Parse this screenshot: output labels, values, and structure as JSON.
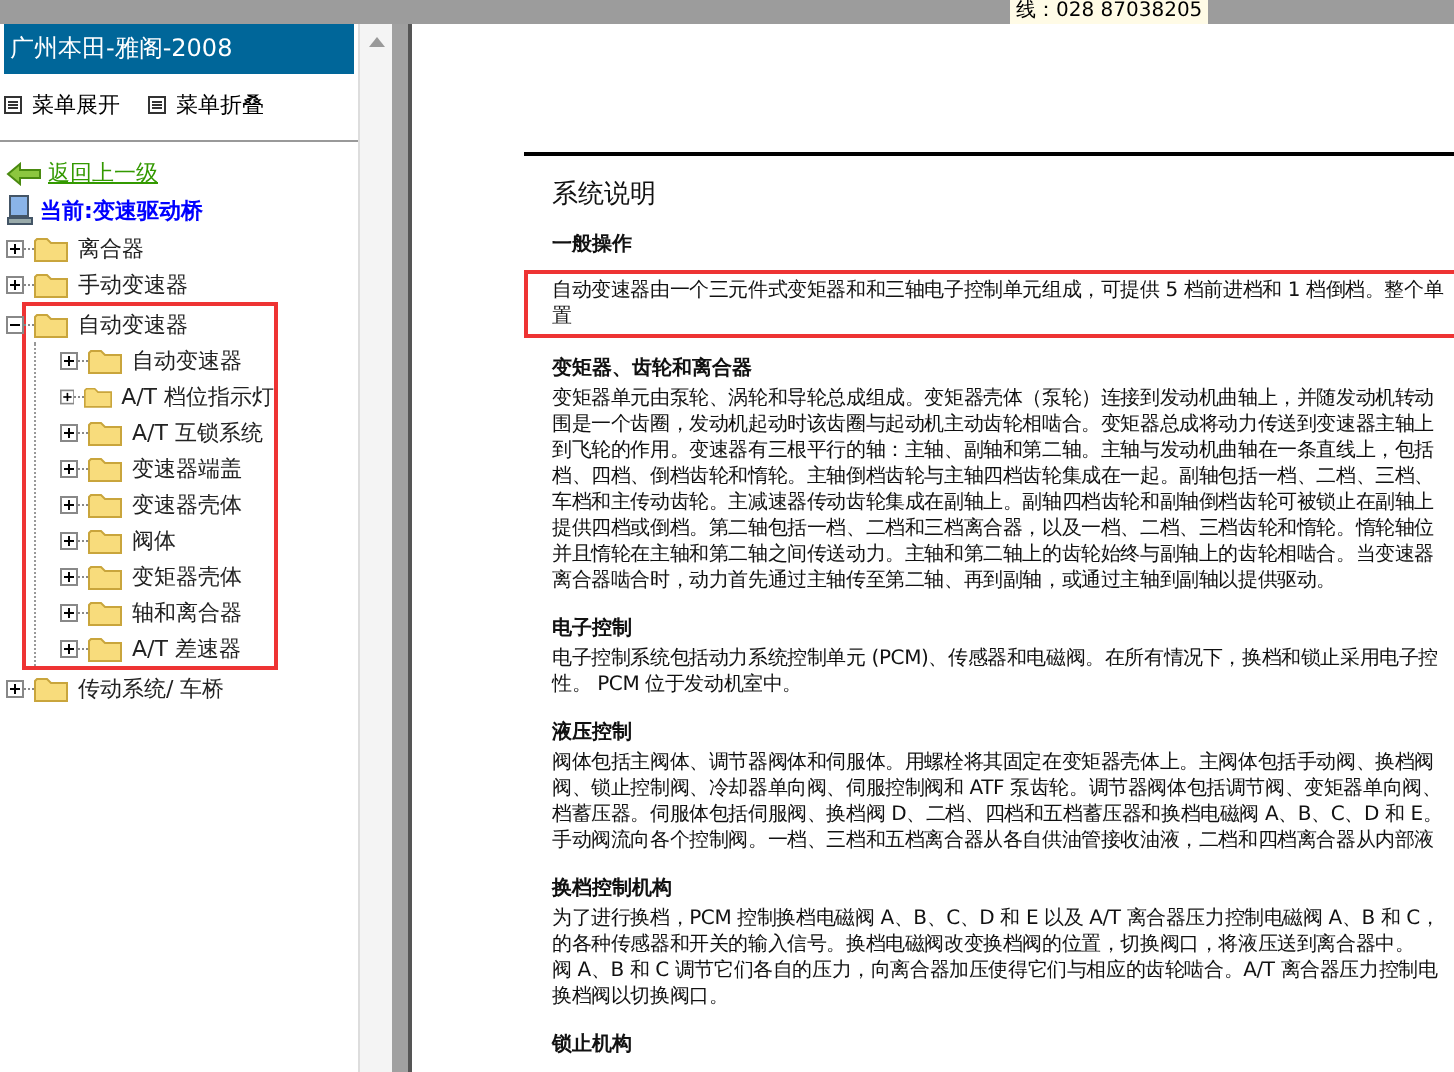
{
  "top_bar": {
    "phone": "线：028 87038205"
  },
  "sidebar": {
    "title": "广州本田-雅阁-2008",
    "menu_actions": [
      {
        "label": "菜单展开"
      },
      {
        "label": "菜单折叠"
      }
    ],
    "back_link": "返回上一级",
    "current": "当前:变速驱动桥",
    "tree": [
      {
        "label": "离合器",
        "expanded": false,
        "highlighted": false
      },
      {
        "label": "手动变速器",
        "expanded": false,
        "highlighted": false
      },
      {
        "label": "自动变速器",
        "expanded": true,
        "highlighted": true,
        "children": [
          {
            "label": "自动变速器",
            "expanded": false,
            "highlighted": false
          },
          {
            "label": "A/T 档位指示灯",
            "expanded": false,
            "highlighted": false
          },
          {
            "label": "A/T 互锁系统",
            "expanded": false,
            "highlighted": false
          },
          {
            "label": "变速器端盖",
            "expanded": false,
            "highlighted": false
          },
          {
            "label": "变速器壳体",
            "expanded": false,
            "highlighted": false
          },
          {
            "label": "阀体",
            "expanded": false,
            "highlighted": false
          },
          {
            "label": "变矩器壳体",
            "expanded": false,
            "highlighted": false
          },
          {
            "label": "轴和离合器",
            "expanded": false,
            "highlighted": false
          },
          {
            "label": "A/T 差速器",
            "expanded": false,
            "highlighted": false
          }
        ]
      },
      {
        "label": "传动系统/ 车桥",
        "expanded": false,
        "highlighted": false
      }
    ]
  },
  "document": {
    "title": "系统说明",
    "sections": [
      {
        "heading": "一般操作",
        "highlighted": true,
        "lines": [
          "自动变速器由一个三元件式变矩器和和三轴电子控制单元组成，可提供 5 档前进档和 1 档倒档。整个单",
          "置"
        ]
      },
      {
        "heading": "变矩器、齿轮和离合器",
        "highlighted": false,
        "lines": [
          "变矩器单元由泵轮、涡轮和导轮总成组成。变矩器壳体（泵轮）连接到发动机曲轴上，并随发动机转动",
          "围是一个齿圈，发动机起动时该齿圈与起动机主动齿轮相啮合。变矩器总成将动力传送到变速器主轴上",
          "到飞轮的作用。变速器有三根平行的轴：主轴、副轴和第二轴。主轴与发动机曲轴在一条直线上，包括",
          "档、四档、倒档齿轮和惰轮。主轴倒档齿轮与主轴四档齿轮集成在一起。副轴包括一档、二档、三档、",
          "车档和主传动齿轮。主减速器传动齿轮集成在副轴上。副轴四档齿轮和副轴倒档齿轮可被锁止在副轴上",
          "提供四档或倒档。第二轴包括一档、二档和三档离合器，以及一档、二档、三档齿轮和惰轮。惰轮轴位",
          "并且惰轮在主轴和第二轴之间传送动力。主轴和第二轴上的齿轮始终与副轴上的齿轮相啮合。当变速器",
          "离合器啮合时，动力首先通过主轴传至第二轴、再到副轴，或通过主轴到副轴以提供驱动。"
        ]
      },
      {
        "heading": "电子控制",
        "highlighted": false,
        "lines": [
          "电子控制系统包括动力系统控制单元 (PCM)、传感器和电磁阀。在所有情况下，换档和锁止采用电子控",
          "性。 PCM 位于发动机室中。"
        ]
      },
      {
        "heading": "液压控制",
        "highlighted": false,
        "lines": [
          "阀体包括主阀体、调节器阀体和伺服体。用螺栓将其固定在变矩器壳体上。主阀体包括手动阀、换档阀",
          "阀、锁止控制阀、冷却器单向阀、伺服控制阀和 ATF 泵齿轮。调节器阀体包括调节阀、变矩器单向阀、",
          "档蓄压器。伺服体包括伺服阀、换档阀 D、二档、四档和五档蓄压器和换档电磁阀 A、B、C、D 和 E。",
          "手动阀流向各个控制阀。一档、三档和五档离合器从各自供油管接收油液，二档和四档离合器从内部液"
        ]
      },
      {
        "heading": "换档控制机构",
        "highlighted": false,
        "lines": [
          "为了进行换档，PCM 控制换档电磁阀 A、B、C、D 和 E 以及 A/T 离合器压力控制电磁阀 A、B 和 C，",
          "的各种传感器和开关的输入信号。换档电磁阀改变换档阀的位置，切换阀口，将液压送到离合器中。",
          "阀 A、B 和 C 调节它们各自的压力，向离合器加压使得它们与相应的齿轮啮合。A/T 离合器压力控制电",
          "换档阀以切换阀口。"
        ]
      },
      {
        "heading": "锁止机构"
      }
    ]
  }
}
